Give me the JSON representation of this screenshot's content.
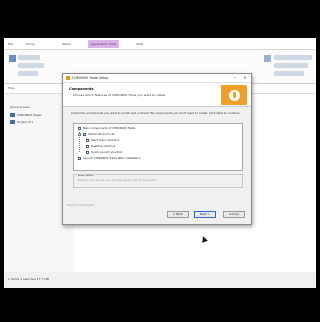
{
  "explorer": {
    "ribbon_tabs": [
      "File",
      "Home",
      "Share",
      "View",
      "Manage"
    ],
    "active_tab": "Application Tools",
    "address_text": "Files",
    "nav_items": [
      "Quick access",
      "CHRONOS Paper",
      "Project (F:)"
    ],
    "status_text": "2 items  1 selected  17.7 MB"
  },
  "installer": {
    "window_title": "CHRONOS Trade Setup",
    "header_title": "Components",
    "header_subtitle": "Choose which features of CHRONOS Trade you want to install.",
    "description": "Check the components you want to install and uncheck the components you don't want to install. Click Next to continue.",
    "components": [
      {
        "label": "Main components of CHRONOS Trade",
        "checked": true,
        "level": 0
      },
      {
        "label": "Shortcuts and links",
        "checked": true,
        "level": 0
      },
      {
        "label": "Start menu shortcut",
        "checked": true,
        "level": 1
      },
      {
        "label": "Desktop shortcut",
        "checked": true,
        "level": 1
      },
      {
        "label": "Quick Launch shortcut",
        "checked": true,
        "level": 1
      },
      {
        "label": "Launch CHRONOS Trade after installation",
        "checked": true,
        "level": 0
      }
    ],
    "info_label": "Description",
    "info_text": "Position your mouse over a component to see its description.",
    "brand_text": "Nullsoft Install System",
    "buttons": {
      "back": "< Back",
      "next": "Next >",
      "cancel": "Cancel"
    },
    "accent_color": "#f0a02a"
  }
}
